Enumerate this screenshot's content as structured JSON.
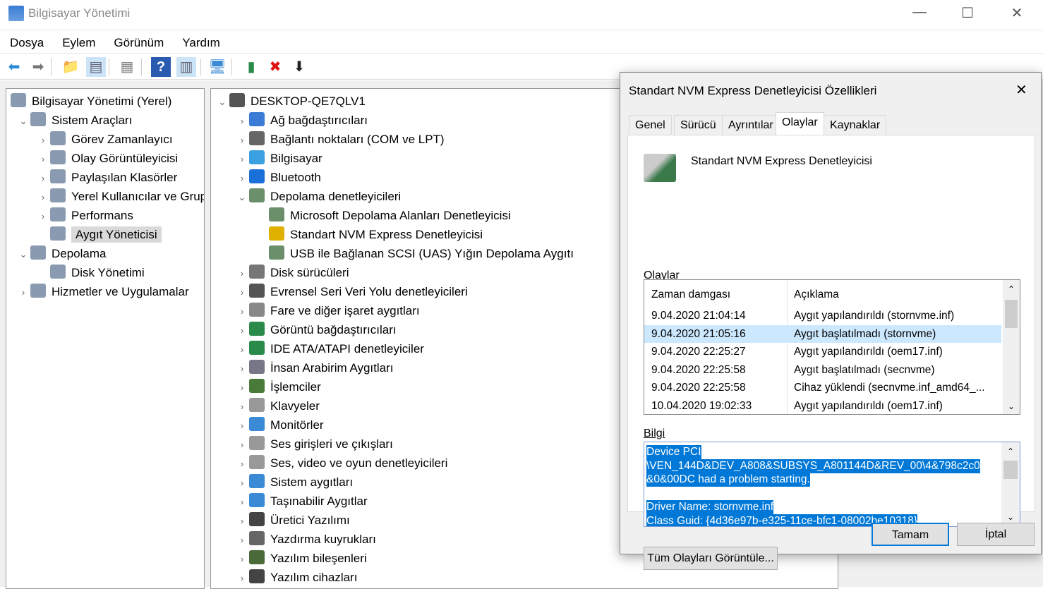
{
  "window": {
    "title": "Bilgisayar Yönetimi",
    "minimize": "—",
    "maximize": "☐",
    "close": "✕"
  },
  "menu": [
    "Dosya",
    "Eylem",
    "Görünüm",
    "Yardım"
  ],
  "toolbar": [
    "back-icon",
    "forward-icon",
    "up-folder-icon",
    "show-hide-tree-icon",
    "properties-icon",
    "help-icon",
    "show-action-pane-icon",
    "scan-hardware-icon",
    "update-driver-icon",
    "uninstall-icon",
    "disable-icon"
  ],
  "left_tree": [
    {
      "label": "Bilgisayar Yönetimi (Yerel)",
      "level": 0,
      "exp": ""
    },
    {
      "label": "Sistem Araçları",
      "level": 1,
      "exp": "⌄"
    },
    {
      "label": "Görev Zamanlayıcı",
      "level": 2,
      "exp": "›"
    },
    {
      "label": "Olay Görüntüleyicisi",
      "level": 2,
      "exp": "›"
    },
    {
      "label": "Paylaşılan Klasörler",
      "level": 2,
      "exp": "›"
    },
    {
      "label": "Yerel Kullanıcılar ve Gruplar",
      "level": 2,
      "exp": "›"
    },
    {
      "label": "Performans",
      "level": 2,
      "exp": "›"
    },
    {
      "label": "Aygıt Yöneticisi",
      "level": 2,
      "exp": "",
      "selected": true
    },
    {
      "label": "Depolama",
      "level": 1,
      "exp": "⌄"
    },
    {
      "label": "Disk Yönetimi",
      "level": 2,
      "exp": ""
    },
    {
      "label": "Hizmetler ve Uygulamalar",
      "level": 1,
      "exp": "›"
    }
  ],
  "device_tree": [
    {
      "label": "DESKTOP-QE7QLV1",
      "level": 0,
      "exp": "⌄",
      "color": "#555"
    },
    {
      "label": "Ağ bağdaştırıcıları",
      "level": 1,
      "exp": "›",
      "color": "#3a7bd5"
    },
    {
      "label": "Bağlantı noktaları (COM ve LPT)",
      "level": 1,
      "exp": "›",
      "color": "#666"
    },
    {
      "label": "Bilgisayar",
      "level": 1,
      "exp": "›",
      "color": "#3aa0e0"
    },
    {
      "label": "Bluetooth",
      "level": 1,
      "exp": "›",
      "color": "#1a6fd8"
    },
    {
      "label": "Depolama denetleyicileri",
      "level": 1,
      "exp": "⌄",
      "color": "#6b8e6b"
    },
    {
      "label": "Microsoft Depolama Alanları Denetleyicisi",
      "level": 2,
      "exp": "",
      "color": "#6b8e6b"
    },
    {
      "label": "Standart NVM Express Denetleyicisi",
      "level": 2,
      "exp": "",
      "color": "#e0b000"
    },
    {
      "label": "USB ile Bağlanan SCSI (UAS) Yığın Depolama Aygıtı",
      "level": 2,
      "exp": "",
      "color": "#6b8e6b"
    },
    {
      "label": "Disk sürücüleri",
      "level": 1,
      "exp": "›",
      "color": "#777"
    },
    {
      "label": "Evrensel Seri Veri Yolu denetleyicileri",
      "level": 1,
      "exp": "›",
      "color": "#555"
    },
    {
      "label": "Fare ve diğer işaret aygıtları",
      "level": 1,
      "exp": "›",
      "color": "#888"
    },
    {
      "label": "Görüntü bağdaştırıcıları",
      "level": 1,
      "exp": "›",
      "color": "#2a8a4a"
    },
    {
      "label": "IDE ATA/ATAPI denetleyiciler",
      "level": 1,
      "exp": "›",
      "color": "#2a8a4a"
    },
    {
      "label": "İnsan Arabirim Aygıtları",
      "level": 1,
      "exp": "›",
      "color": "#778"
    },
    {
      "label": "İşlemciler",
      "level": 1,
      "exp": "›",
      "color": "#4a7a3a"
    },
    {
      "label": "Klavyeler",
      "level": 1,
      "exp": "›",
      "color": "#999"
    },
    {
      "label": "Monitörler",
      "level": 1,
      "exp": "›",
      "color": "#3a8ad5"
    },
    {
      "label": "Ses girişleri ve çıkışları",
      "level": 1,
      "exp": "›",
      "color": "#999"
    },
    {
      "label": "Ses, video ve oyun denetleyicileri",
      "level": 1,
      "exp": "›",
      "color": "#999"
    },
    {
      "label": "Sistem aygıtları",
      "level": 1,
      "exp": "›",
      "color": "#3a8ad5"
    },
    {
      "label": "Taşınabilir Aygıtlar",
      "level": 1,
      "exp": "›",
      "color": "#3a8ad5"
    },
    {
      "label": "Üretici Yazılımı",
      "level": 1,
      "exp": "›",
      "color": "#444"
    },
    {
      "label": "Yazdırma kuyrukları",
      "level": 1,
      "exp": "›",
      "color": "#666"
    },
    {
      "label": "Yazılım bileşenleri",
      "level": 1,
      "exp": "›",
      "color": "#4a6a3a"
    },
    {
      "label": "Yazılım cihazları",
      "level": 1,
      "exp": "›",
      "color": "#444"
    }
  ],
  "dialog": {
    "title": "Standart NVM Express Denetleyicisi Özellikleri",
    "close": "✕",
    "tabs": [
      "Genel",
      "Sürücü",
      "Ayrıntılar",
      "Olaylar",
      "Kaynaklar"
    ],
    "active_tab": "Olaylar",
    "device_name": "Standart NVM Express Denetleyicisi",
    "events_label": "Olaylar",
    "columns": [
      "Zaman damgası",
      "Açıklama"
    ],
    "events": [
      [
        "9.04.2020 21:04:14",
        "Aygıt yapılandırıldı (stornvme.inf)"
      ],
      [
        "9.04.2020 21:05:16",
        "Aygıt başlatılmadı (stornvme)"
      ],
      [
        "9.04.2020 22:25:27",
        "Aygıt yapılandırıldı (oem17.inf)"
      ],
      [
        "9.04.2020 22:25:58",
        "Aygıt başlatılmadı (secnvme)"
      ],
      [
        "9.04.2020 22:25:58",
        "Cihaz yüklendi (secnvme.inf_amd64_..."
      ],
      [
        "10.04.2020 19:02:33",
        "Aygıt yapılandırıldı (oem17.inf)"
      ]
    ],
    "selected_event": 1,
    "info_label": "Bilgi",
    "info_lines": [
      "Device PCI",
      "\\VEN_144D&DEV_A808&SUBSYS_A801144D&REV_00\\4&798c2c0",
      "&0&00DC had a problem starting.",
      "",
      "Driver Name: stornvme.inf",
      "Class Guid: {4d36e97b-e325-11ce-bfc1-08002be10318}"
    ],
    "view_all_button": "Tüm Olayları Görüntüle...",
    "ok_button": "Tamam",
    "cancel_button": "İptal"
  }
}
